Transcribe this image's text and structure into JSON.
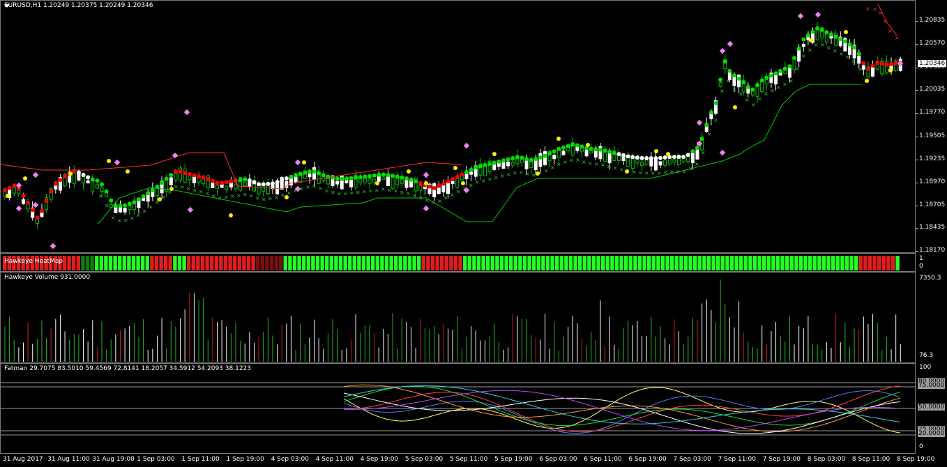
{
  "main": {
    "header": "EURUSD,H1  1.20249 1.20375 1.20249 1.20346",
    "price_ticks": [
      "1.20835",
      "1.20570",
      "1.20300",
      "1.20035",
      "1.19770",
      "1.19505",
      "1.19235",
      "1.18970",
      "1.18705",
      "1.18435",
      "1.18170"
    ],
    "current_price": "1.20346"
  },
  "heatmap": {
    "label": "Hawkeye HeatMap",
    "ticks": [
      "1",
      "0"
    ],
    "colors": {
      "green": "#22ff22",
      "red": "#e11c1c",
      "darkred": "#7a0f0f",
      "darkgreen": "#0f7a0f"
    }
  },
  "volume": {
    "label": "Hawkeye Volume 931.0000",
    "ticks": [
      "7350.3",
      "76.3"
    ]
  },
  "fatman": {
    "label": "Fatman 29.7075 83.5010 59.4569 72.8141 18.2057 34.5912 54.2093 38.1223",
    "ticks": [
      "100",
      "0"
    ],
    "level_tags": [
      "80.0000",
      "75.0000",
      "50.0000",
      "25.0000",
      "20.0000"
    ]
  },
  "time_axis": [
    "31 Aug 2017",
    "31 Aug 11:00",
    "31 Aug 19:00",
    "1 Sep 03:00",
    "1 Sep 11:00",
    "1 Sep 19:00",
    "4 Sep 03:00",
    "4 Sep 11:00",
    "4 Sep 19:00",
    "5 Sep 03:00",
    "5 Sep 11:00",
    "5 Sep 19:00",
    "6 Sep 03:00",
    "6 Sep 11:00",
    "6 Sep 19:00",
    "7 Sep 03:00",
    "7 Sep 11:00",
    "7 Sep 19:00",
    "8 Sep 03:00",
    "8 Sep 11:00",
    "8 Sep 19:00"
  ],
  "colors": {
    "bull": "#00c000",
    "bear": "#ffffff",
    "up_dot": "#00e000",
    "down_dot": "#ff0000",
    "neutral_dot": "#ffffff",
    "marker": "#ffee00",
    "magenta": "#ee82ee",
    "stop": "#00cc00",
    "stop_red": "#ff3030"
  }
}
